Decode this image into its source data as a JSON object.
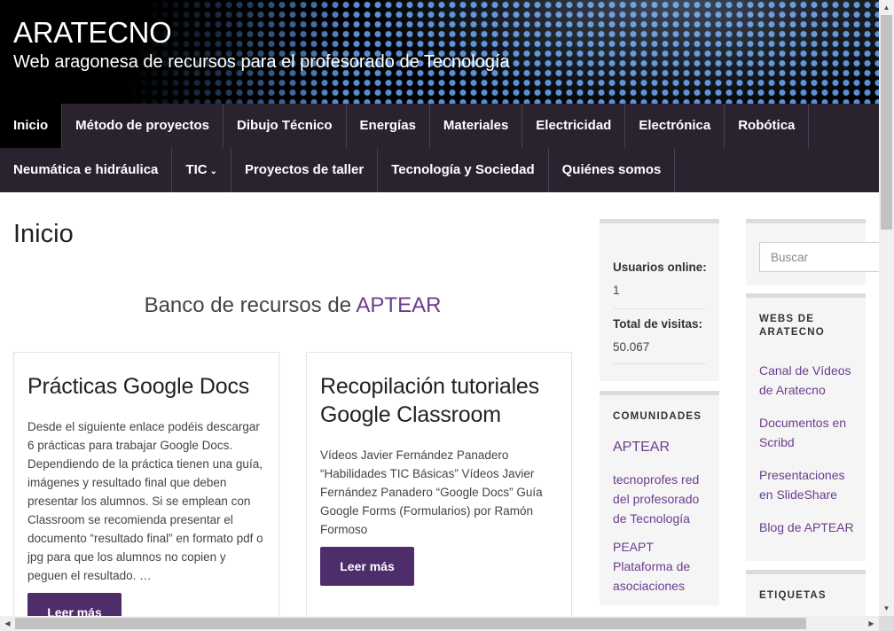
{
  "header": {
    "site_title": "ARATECNO",
    "site_description": "Web aragonesa de recursos para el profesorado de Tecnología"
  },
  "nav": {
    "row1": [
      {
        "label": "Inicio",
        "active": true
      },
      {
        "label": "Método de proyectos"
      },
      {
        "label": "Dibujo Técnico"
      },
      {
        "label": "Energías"
      },
      {
        "label": "Materiales"
      },
      {
        "label": "Electricidad"
      },
      {
        "label": "Electrónica"
      },
      {
        "label": "Robótica"
      }
    ],
    "row2": [
      {
        "label": "Neumática e hidráulica"
      },
      {
        "label": "TIC",
        "caret": "⌄"
      },
      {
        "label": "Proyectos de taller"
      },
      {
        "label": "Tecnología y Sociedad"
      },
      {
        "label": "Quiénes somos"
      }
    ]
  },
  "main": {
    "page_title": "Inicio",
    "bank_prefix": "Banco de recursos de ",
    "bank_link": "APTEAR",
    "cards": [
      {
        "title": "Prácticas Google Docs",
        "excerpt": "Desde el siguiente enlace podéis descargar 6 prácticas para trabajar Google Docs. Dependiendo de la práctica tienen una guía, imágenes y resultado final que deben presentar los alumnos. Si se emplean con Classroom se recomienda presentar el documento “resultado final” en formato pdf o jpg para que los alumnos no copien y peguen el resultado. …",
        "button": "Leer más"
      },
      {
        "title": "Recopilación tutoriales Google Classroom",
        "excerpt": "Vídeos Javier Fernández Panadero “Habilidades TIC Básicas” Vídeos Javier Fernández Panadero “Google Docs” Guía Google Forms (Formularios) por Ramón Formoso",
        "button": "Leer más"
      }
    ]
  },
  "sidebar1": {
    "online_label": "Usuarios online:",
    "online_value": "1",
    "visits_label": "Total de visitas:",
    "visits_value": "50.067",
    "comunidades": {
      "title": "COMUNIDADES",
      "links": [
        "APTEAR",
        "tecnoprofes red del profesorado de Tecnología",
        "PEAPT Plataforma de asociaciones"
      ]
    }
  },
  "sidebar2": {
    "search_placeholder": "Buscar",
    "webs": {
      "title": "WEBS DE ARATECNO",
      "links": [
        "Canal de Vídeos de Aratecno",
        "Documentos en Scribd",
        "Presentaciones en SlideShare",
        "Blog de APTEAR"
      ]
    },
    "etiquetas_title": "ETIQUETAS"
  },
  "scrollbars": {
    "up_arrow": "▲",
    "down_arrow": "▼",
    "left_arrow": "◀",
    "right_arrow": "▶"
  },
  "colors": {
    "nav_bg": "#2b2230",
    "accent_link": "#6c3d8e",
    "button_bg": "#4e2d6b"
  }
}
